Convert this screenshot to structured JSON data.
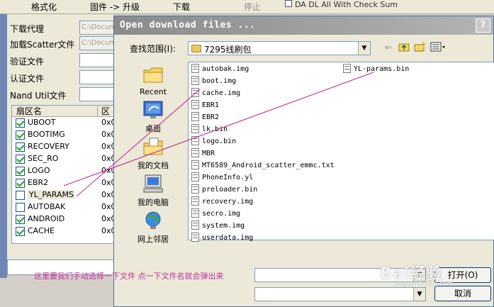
{
  "toolbar": {
    "format": "格式化",
    "firmware_upgrade": "固件 -> 升级",
    "download": "下载",
    "stop": "停止",
    "da_dl_check": "DA DL All With Check Sum"
  },
  "left_panel": {
    "download_agent_label": "下载代理",
    "download_agent_value": "C:\\Docum",
    "scatter_label": "加载Scatter文件",
    "scatter_value": "C:\\Docum",
    "auth_file_label": "验证文件",
    "cert_file_label": "认证文件",
    "nand_util_label": "Nand Util文件"
  },
  "partition_list": {
    "col_name": "扇区名",
    "col_addr": "区",
    "rows": [
      {
        "name": "UBOOT",
        "addr": "0x0",
        "checked": true
      },
      {
        "name": "BOOTIMG",
        "addr": "0x0",
        "checked": true
      },
      {
        "name": "RECOVERY",
        "addr": "0x0",
        "checked": true
      },
      {
        "name": "SEC_RO",
        "addr": "0x0",
        "checked": true
      },
      {
        "name": "LOGO",
        "addr": "0x0",
        "checked": true
      },
      {
        "name": "EBR2",
        "addr": "0x0",
        "checked": true
      },
      {
        "name": "YL_PARAMS",
        "addr": "0x0",
        "checked": false
      },
      {
        "name": "AUTOBAK",
        "addr": "0x0",
        "checked": false
      },
      {
        "name": "ANDROID",
        "addr": "0x0",
        "checked": true
      },
      {
        "name": "CACHE",
        "addr": "0x0",
        "checked": true
      }
    ]
  },
  "dialog": {
    "title": "Open download files ...",
    "help": "?",
    "look_in_label": "查找范围(I):",
    "look_in_value": "7295线刷包",
    "places": [
      {
        "label": "Recent",
        "icon": "recent-folder-icon"
      },
      {
        "label": "桌面",
        "icon": "desktop-icon"
      },
      {
        "label": "我的文档",
        "icon": "my-documents-icon"
      },
      {
        "label": "我的电脑",
        "icon": "my-computer-icon"
      },
      {
        "label": "网上邻居",
        "icon": "network-places-icon"
      }
    ],
    "files": [
      "autobak.img",
      "boot.img",
      "cache.img",
      "EBR1",
      "EBR2",
      "lk.bin",
      "logo.bin",
      "MBR",
      "MT6589_Android_scatter_emmc.txt",
      "PhoneInfo.yl",
      "preloader.bin",
      "recovery.img",
      "secro.img",
      "system.img",
      "userdata.img",
      "YL-params.bin"
    ],
    "open_button": "打开(O)",
    "cancel_button": "取消"
  },
  "annotation": "这里要我们手动选择一下文件  点一下文件名就会弹出来",
  "watermark": "Bai经验",
  "watermark_sub": "jingyan.baidu.com",
  "colors": {
    "annotation": "#c02f9a",
    "title_bar": "#8b8b8b",
    "pointer_lines": "#c0208a"
  }
}
